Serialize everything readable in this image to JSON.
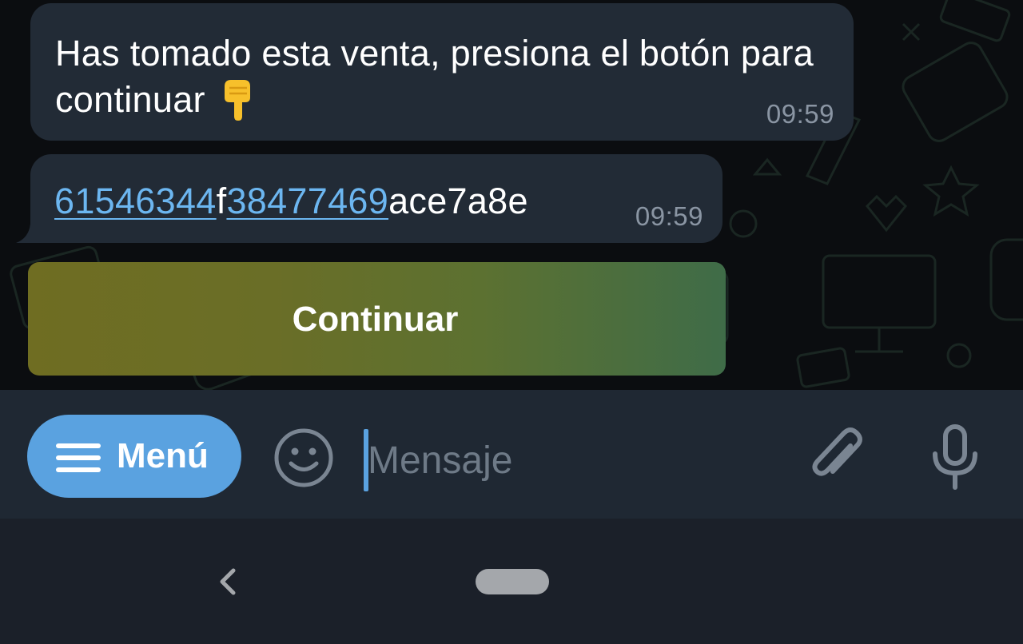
{
  "messages": [
    {
      "text": "Has tomado esta venta, presiona el botón para continuar",
      "emoji": "backhand-index-pointing-down",
      "time": "09:59"
    },
    {
      "segments": [
        {
          "text": "61546344",
          "link": true
        },
        {
          "text": "f",
          "link": false
        },
        {
          "text": "38477469",
          "link": true
        },
        {
          "text": "ace7a8e",
          "link": false
        }
      ],
      "time": "09:59"
    }
  ],
  "inline_button": {
    "label": "Continuar"
  },
  "input_bar": {
    "menu_label": "Menú",
    "placeholder": "Mensaje",
    "value": ""
  },
  "icons": {
    "menu": "hamburger-icon",
    "emoji": "smiley-icon",
    "attach": "paperclip-icon",
    "mic": "microphone-icon",
    "back": "chevron-left-icon",
    "home": "home-pill"
  },
  "colors": {
    "bubble": "#222b36",
    "link": "#6cb6f0",
    "accent": "#5aa2e0",
    "input_bar": "#1f2833",
    "button_gradient_start": "#6f6d22",
    "button_gradient_end": "#3f6c48"
  }
}
